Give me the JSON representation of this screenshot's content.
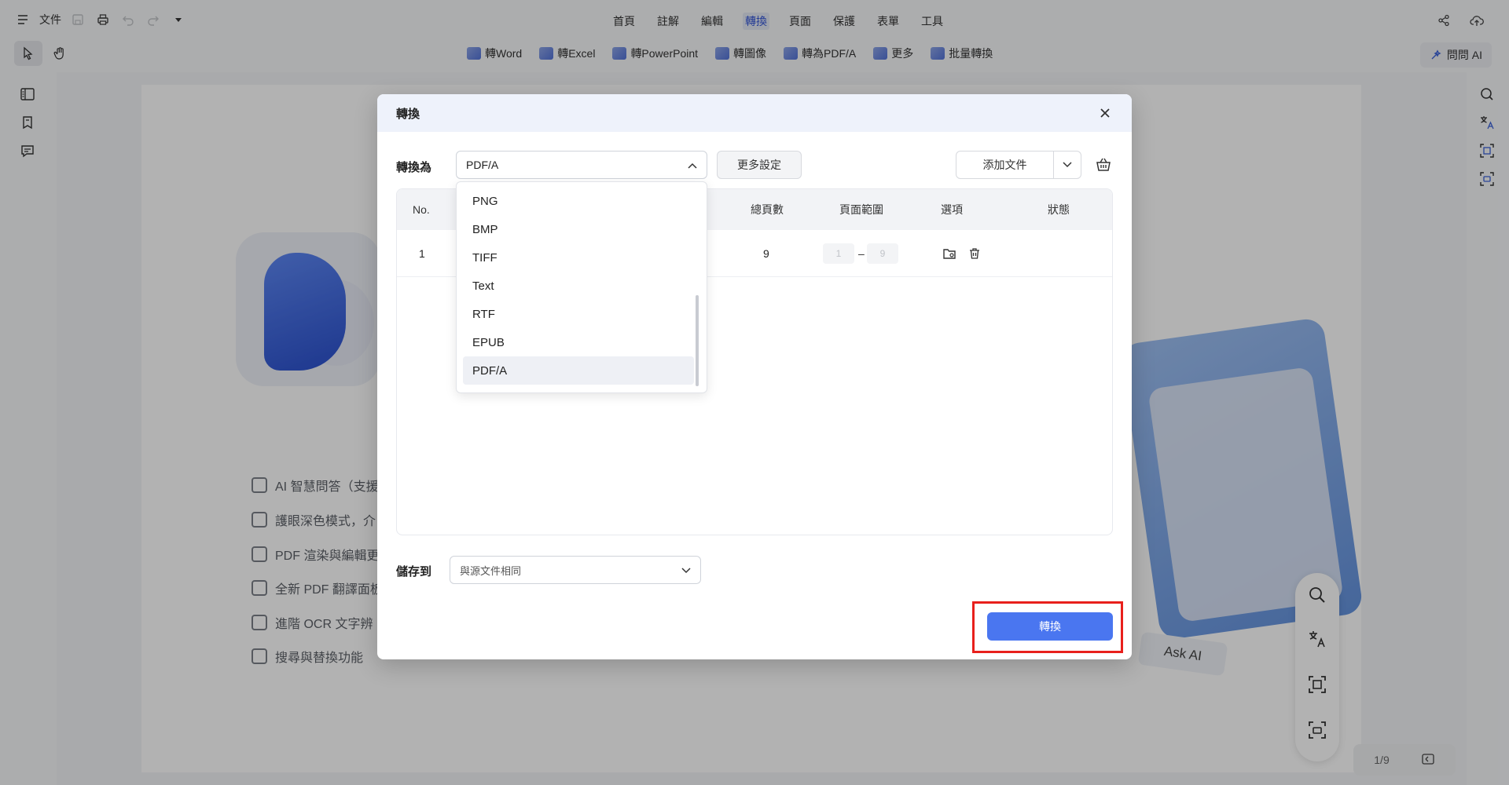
{
  "topbar": {
    "file_label": "文件",
    "menu": [
      "首頁",
      "註解",
      "編輯",
      "轉換",
      "頁面",
      "保護",
      "表單",
      "工具"
    ],
    "active_menu": "轉換"
  },
  "toolbar": {
    "convert_items": [
      "轉Word",
      "轉Excel",
      "轉PowerPoint",
      "轉圖像",
      "轉為PDF/A",
      "更多",
      "批量轉換"
    ],
    "ask_ai": "問問 AI"
  },
  "background": {
    "features": [
      "AI 智慧問答（支援",
      "護眼深色模式，介",
      "PDF 渲染與編輯更",
      "全新 PDF 翻譯面板",
      "進階 OCR 文字辨",
      "搜尋與替換功能"
    ],
    "ask_ai_label": "Ask AI",
    "pager": "1/9"
  },
  "dialog": {
    "title": "轉換",
    "convert_to_label": "轉換為",
    "format_selected": "PDF/A",
    "more_settings": "更多設定",
    "add_file": "添加文件",
    "table": {
      "headers": [
        "No.",
        "總頁數",
        "頁面範圍",
        "選項",
        "狀態"
      ],
      "rows": [
        {
          "no": "1",
          "total_pages": "9",
          "range_from": "1",
          "range_sep": "–",
          "range_to": "9",
          "status": ""
        }
      ]
    },
    "format_options": [
      "PNG",
      "BMP",
      "TIFF",
      "Text",
      "RTF",
      "EPUB",
      "PDF/A"
    ],
    "save_to_label": "儲存到",
    "save_to_value": "與源文件相同",
    "convert_button": "轉換"
  },
  "highlight_color": "#e8201c",
  "accent_color": "#4a76f0"
}
